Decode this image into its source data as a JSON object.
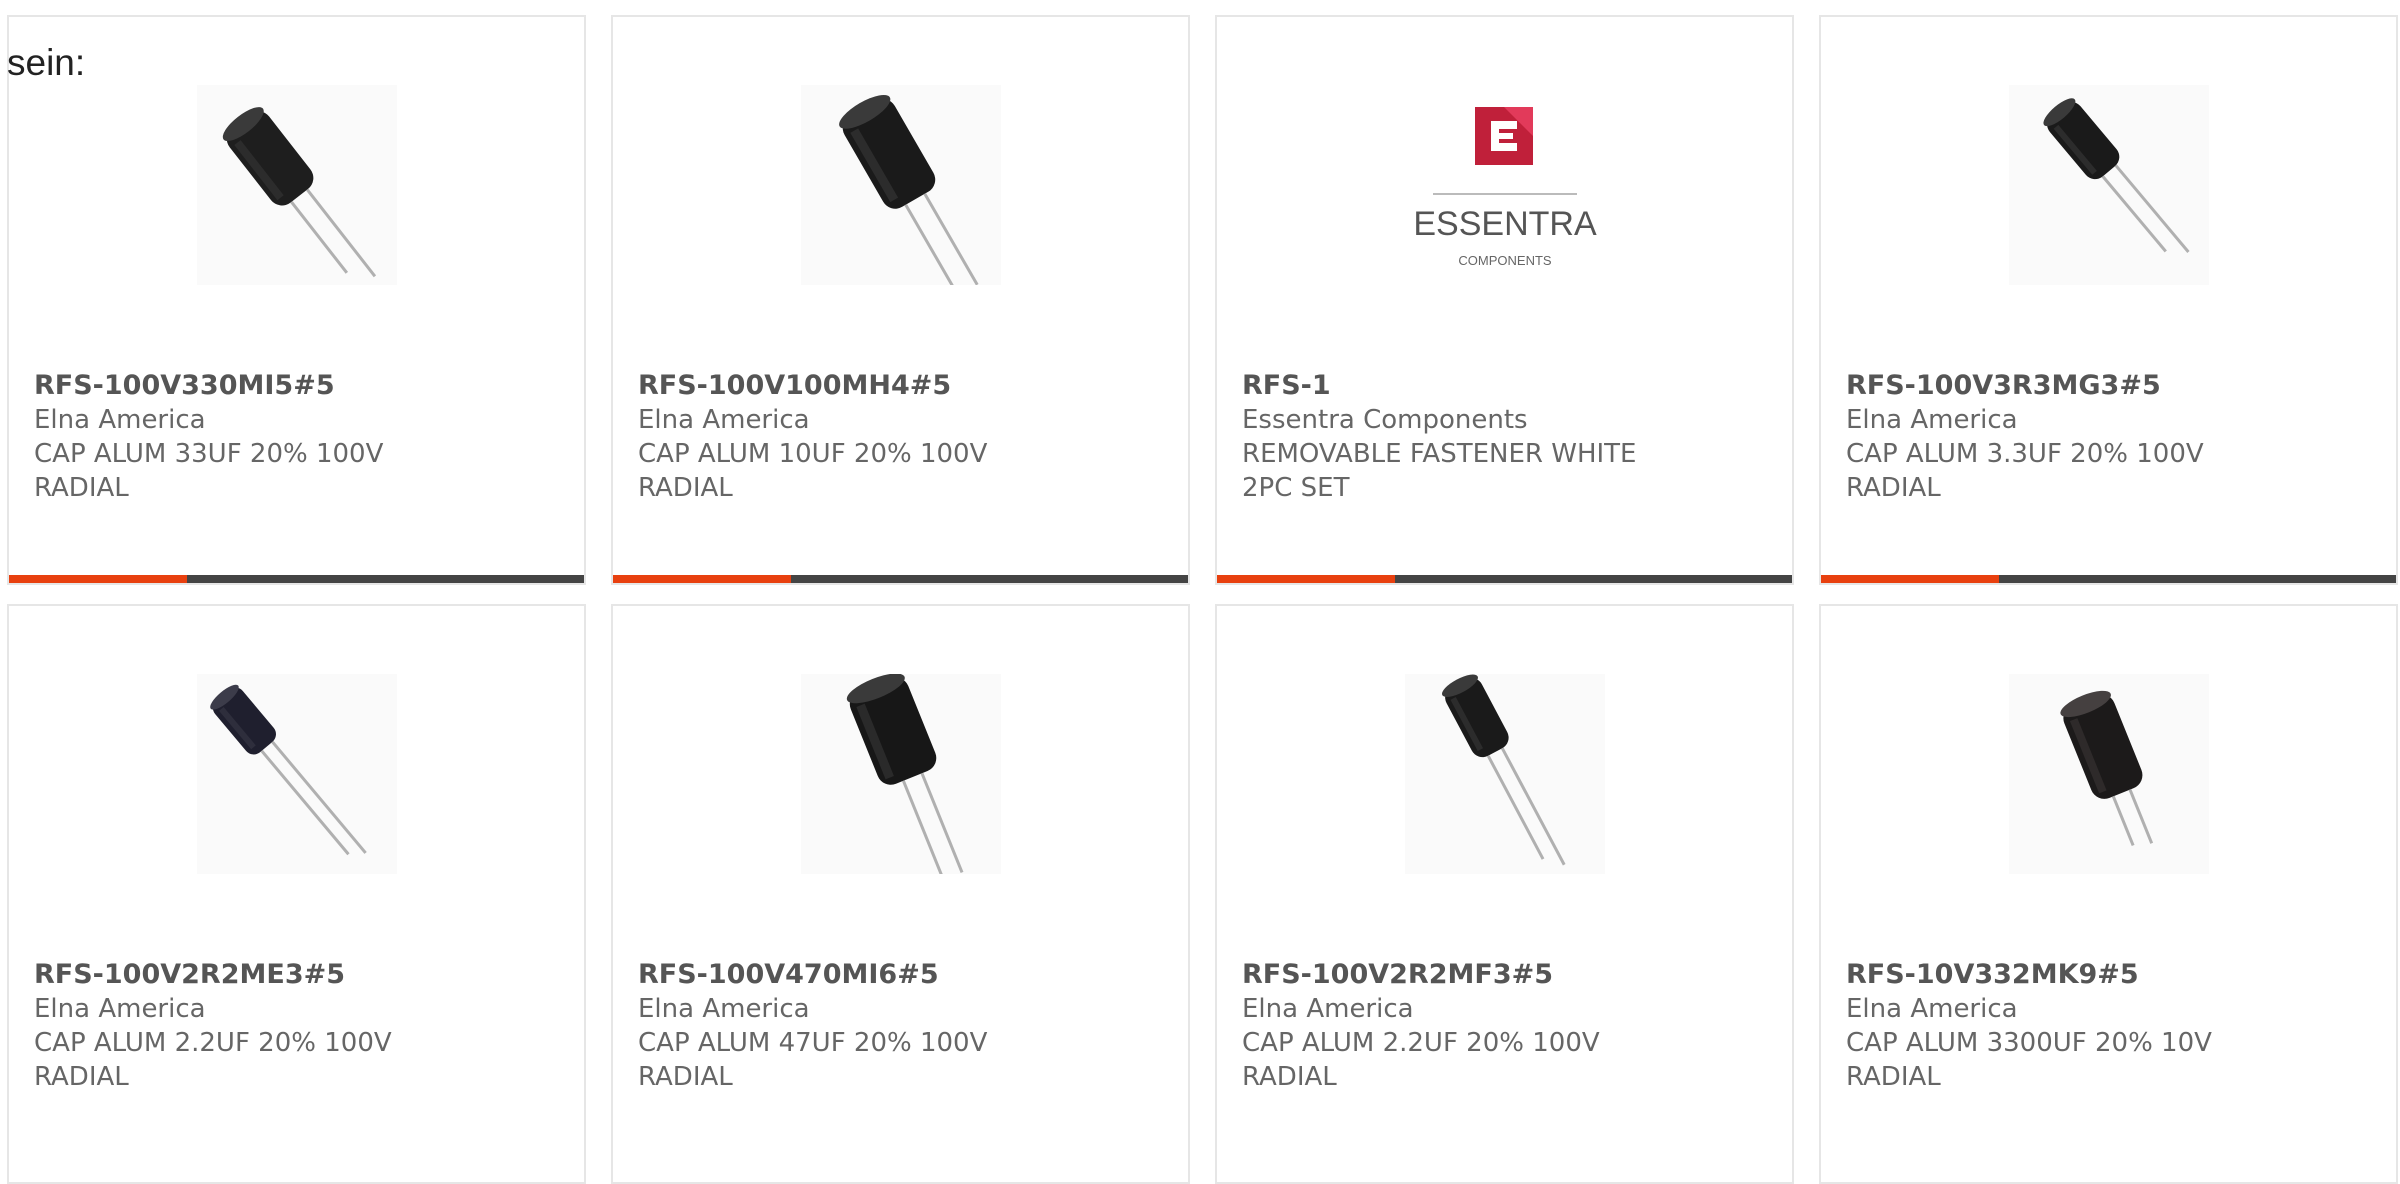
{
  "page": {
    "prefix_text": "sein:"
  },
  "colors": {
    "accent": "#e8400f",
    "bar_track": "#444444",
    "card_border": "#e6e6e6",
    "part_number": "#555555",
    "text": "#666666"
  },
  "products": [
    {
      "part_number": "RFS-100V330MI5#5",
      "manufacturer": "Elna America",
      "description": "CAP ALUM 33UF 20% 100V\nRADIAL",
      "image": "capacitor-image",
      "progress_fraction": 0.31
    },
    {
      "part_number": "RFS-100V100MH4#5",
      "manufacturer": "Elna America",
      "description": "CAP ALUM 10UF 20% 100V\nRADIAL",
      "image": "capacitor-image",
      "progress_fraction": 0.31
    },
    {
      "part_number": "RFS-1",
      "manufacturer": "Essentra Components",
      "description": "REMOVABLE FASTENER WHITE\n2PC SET",
      "image": "essentra-logo",
      "logo_text": "ESSENTRA",
      "logo_subtext": "COMPONENTS",
      "progress_fraction": 0.31
    },
    {
      "part_number": "RFS-100V3R3MG3#5",
      "manufacturer": "Elna America",
      "description": "CAP ALUM 3.3UF 20% 100V\nRADIAL",
      "image": "capacitor-image",
      "progress_fraction": 0.31
    },
    {
      "part_number": "RFS-100V2R2ME3#5",
      "manufacturer": "Elna America",
      "description": "CAP ALUM 2.2UF 20% 100V\nRADIAL",
      "image": "capacitor-image"
    },
    {
      "part_number": "RFS-100V470MI6#5",
      "manufacturer": "Elna America",
      "description": "CAP ALUM 47UF 20% 100V\nRADIAL",
      "image": "capacitor-image"
    },
    {
      "part_number": "RFS-100V2R2MF3#5",
      "manufacturer": "Elna America",
      "description": "CAP ALUM 2.2UF 20% 100V\nRADIAL",
      "image": "capacitor-image"
    },
    {
      "part_number": "RFS-10V332MK9#5",
      "manufacturer": "Elna America",
      "description": "CAP ALUM 3300UF 20% 10V\nRADIAL",
      "image": "capacitor-image"
    }
  ]
}
